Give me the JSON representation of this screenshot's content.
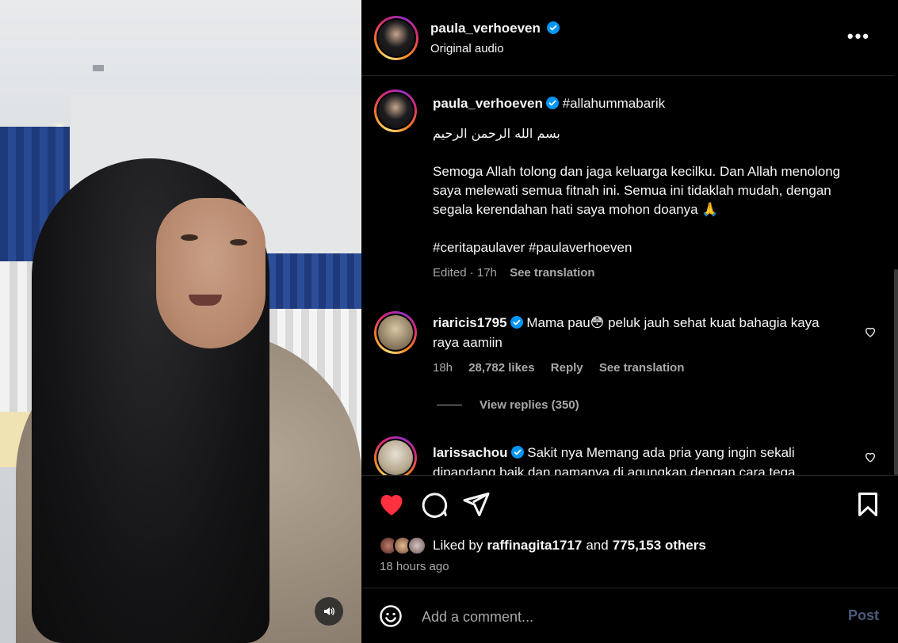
{
  "header": {
    "username": "paula_verhoeven",
    "audio": "Original audio",
    "more_label": "•••"
  },
  "caption": {
    "username": "paula_verhoeven",
    "hashtag_inline": "#allahummabarik",
    "line_arabic": "بسم الله الرحمن الرحيم",
    "paragraph": "Semoga Allah tolong dan jaga keluarga kecilku. Dan Allah menolong saya melewati semua fitnah ini. Semua ini tidaklah mudah, dengan segala kerendahan hati saya mohon doanya 🙏",
    "hashtags": "#ceritapaulaver #paulaverhoeven",
    "edited": "Edited · 17h",
    "see_translation": "See translation"
  },
  "comments": [
    {
      "username": "riaricis1795",
      "text": "Mama pau😳  peluk jauh sehat kuat bahagia kaya raya aamiin",
      "time": "18h",
      "likes": "28,782 likes",
      "reply": "Reply",
      "see_translation": "See translation",
      "view_replies": "View replies (350)"
    },
    {
      "username": "larissachou",
      "text": "Sakit nya Memang ada pria yang ingin sekali dipandang baik dan namanya di agungkan dengan cara tega"
    }
  ],
  "likes": {
    "prefix": "Liked by",
    "user": "raffinagita1717",
    "joiner": "and",
    "others": "775,153 others",
    "time_ago": "18 hours ago"
  },
  "comment_box": {
    "placeholder": "Add a comment...",
    "post_label": "Post"
  },
  "colors": {
    "like_red": "#ff3040",
    "verified_blue": "#0095f6",
    "muted_text": "#a8a8a8",
    "post_disabled": "#4b5a7a"
  }
}
